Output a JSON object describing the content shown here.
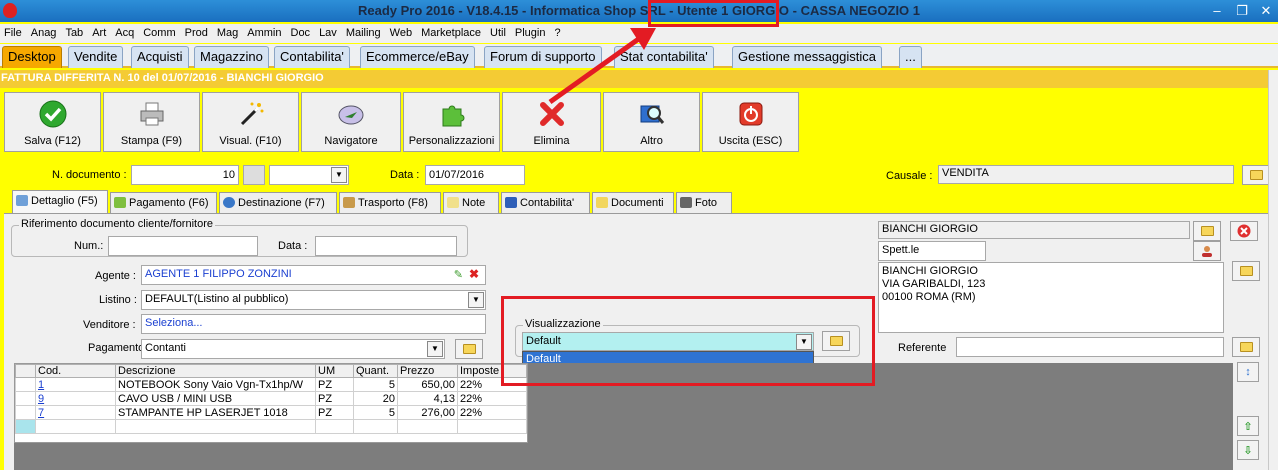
{
  "window": {
    "title": "Ready Pro 2016 - V18.4.15 - Informatica Shop SRL - Utente 1 GIORGIO - CASSA NEGOZIO 1"
  },
  "menu": [
    "File",
    "Anag",
    "Tab",
    "Art",
    "Acq",
    "Comm",
    "Prod",
    "Mag",
    "Ammin",
    "Doc",
    "Lav",
    "Mailing",
    "Web",
    "Marketplace",
    "Util",
    "Plugin",
    "?"
  ],
  "module_tabs": [
    "Desktop",
    "Vendite",
    "Acquisti",
    "Magazzino",
    "Contabilita'",
    "Ecommerce/eBay",
    "Forum di supporto",
    "Stat contabilita'",
    "Gestione messaggistica",
    "..."
  ],
  "document_title": "FATTURA DIFFERITA N. 10 del 01/07/2016 - BIANCHI GIORGIO",
  "toolbar": {
    "save": "Salva (F12)",
    "print": "Stampa (F9)",
    "view": "Visual. (F10)",
    "navigator": "Navigatore",
    "customize": "Personalizzazioni",
    "delete": "Elimina",
    "other": "Altro",
    "exit": "Uscita (ESC)"
  },
  "header_fields": {
    "doc_number_label": "N. documento :",
    "doc_number": "10",
    "date_label": "Data :",
    "date": "01/07/2016",
    "causale_label": "Causale :",
    "causale": "VENDITA"
  },
  "detail_tabs": [
    "Dettaglio (F5)",
    "Pagamento (F6)",
    "Destinazione (F7)",
    "Trasporto (F8)",
    "Note",
    "Contabilita'",
    "Documenti",
    "Foto"
  ],
  "reference": {
    "group_title": "Riferimento documento cliente/fornitore",
    "num_label": "Num.:",
    "num": "",
    "date_label": "Data :",
    "date": ""
  },
  "form": {
    "agent_label": "Agente :",
    "agent": "AGENTE 1 FILIPPO ZONZINI",
    "pricelist_label": "Listino :",
    "pricelist": "DEFAULT(Listino al pubblico)",
    "seller_label": "Venditore :",
    "seller": "Seleziona...",
    "payment_label": "Pagamento :",
    "payment": "Contanti"
  },
  "visualizzazione": {
    "group_title": "Visualizzazione",
    "selected": "Default",
    "options": [
      "Default"
    ]
  },
  "customer": {
    "name": "BIANCHI GIORGIO",
    "salutation": "Spett.le",
    "address_lines": [
      "BIANCHI GIORGIO",
      "VIA GARIBALDI, 123",
      "00100 ROMA (RM)"
    ],
    "referente_label": "Referente",
    "referente": ""
  },
  "grid": {
    "columns": [
      "Cod.",
      "Descrizione",
      "UM",
      "Quant.",
      "Prezzo",
      "Imposte"
    ],
    "rows": [
      {
        "cod": "1",
        "desc": "NOTEBOOK Sony Vaio Vgn-Tx1hp/W",
        "um": "PZ",
        "qty": "5",
        "price": "650,00",
        "tax": "22%"
      },
      {
        "cod": "9",
        "desc": "CAVO USB / MINI USB",
        "um": "PZ",
        "qty": "20",
        "price": "4,13",
        "tax": "22%"
      },
      {
        "cod": "7",
        "desc": "STAMPANTE HP LASERJET 1018",
        "um": "PZ",
        "qty": "5",
        "price": "276,00",
        "tax": "22%"
      }
    ]
  },
  "colors": {
    "form_background": "#ffff00",
    "active_tab": "#f6a800",
    "highlight_red": "#e31b23",
    "titlebar": "#1a6fbf"
  }
}
